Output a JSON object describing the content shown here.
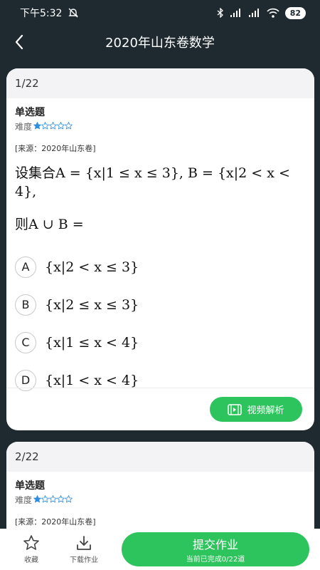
{
  "status": {
    "time": "下午5:32",
    "battery": "82"
  },
  "header": {
    "title": "2020年山东卷数学"
  },
  "questions": [
    {
      "index": "1/22",
      "type": "单选题",
      "difficulty_label": "难度",
      "difficulty_stars": 1,
      "difficulty_max": 5,
      "source": "[来源：2020年山东卷]",
      "stem_line1": "设集合A = {x|1 ≤ x ≤ 3}, B = {x|2 < x < 4},",
      "stem_line2": "则A ∪ B =",
      "options": [
        {
          "letter": "A",
          "text": "{x|2 < x ≤ 3}"
        },
        {
          "letter": "B",
          "text": "{x|2 ≤ x ≤ 3}"
        },
        {
          "letter": "C",
          "text": "{x|1 ≤ x < 4}"
        },
        {
          "letter": "D",
          "text": "{x|1 < x < 4}"
        }
      ],
      "video_label": "视频解析"
    },
    {
      "index": "2/22",
      "type": "单选题",
      "difficulty_label": "难度",
      "difficulty_stars": 1,
      "difficulty_max": 5,
      "source": "[来源：2020年山东卷]"
    }
  ],
  "bottom": {
    "collect_label": "收藏",
    "download_label": "下载作业",
    "submit_label": "提交作业",
    "submit_sub": "当前已完成0/22道"
  },
  "colors": {
    "accent": "#2ec45d",
    "star": "#2e8fe0",
    "background": "#1f2a30"
  }
}
